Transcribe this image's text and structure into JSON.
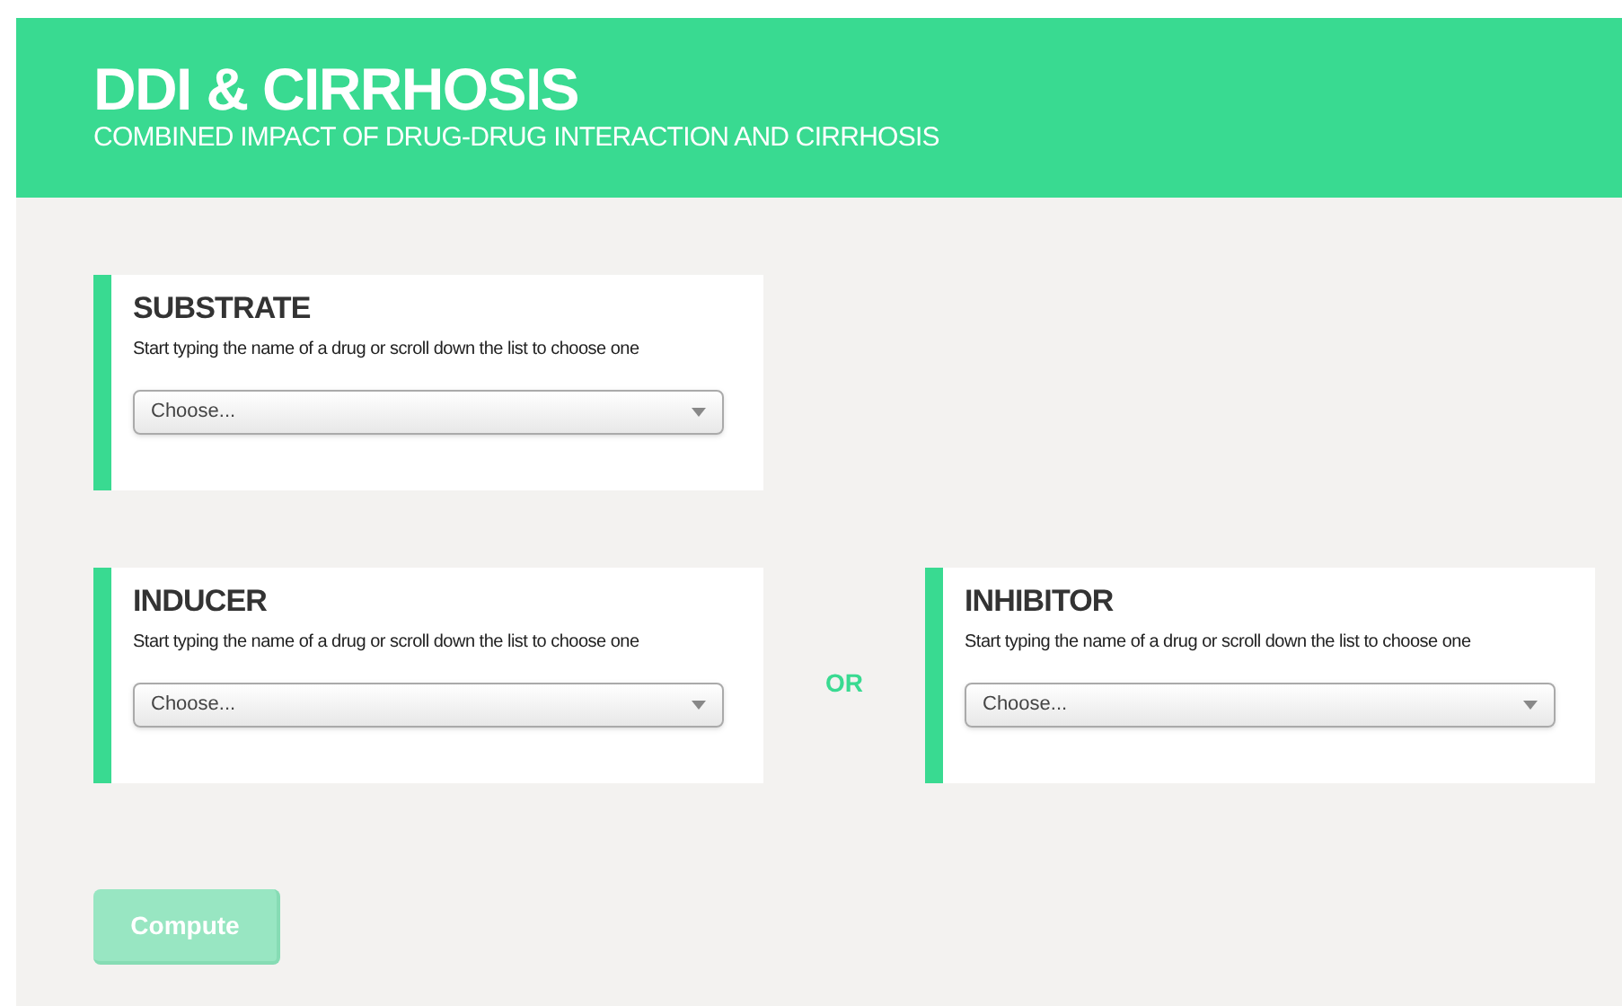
{
  "header": {
    "title": "DDI & CIRRHOSIS",
    "subtitle": "COMBINED IMPACT OF DRUG-DRUG INTERACTION AND CIRRHOSIS"
  },
  "substrate": {
    "title": "SUBSTRATE",
    "description": "Start typing the name of a drug or scroll down the list to choose one",
    "select": "Choose..."
  },
  "inducer": {
    "title": "INDUCER",
    "description": "Start typing the name of a drug or scroll down the list to choose one",
    "select": "Choose..."
  },
  "separator": "OR",
  "inhibitor": {
    "title": "INHIBITOR",
    "description": "Start typing the name of a drug or scroll down the list to choose one",
    "select": "Choose..."
  },
  "compute_button": {
    "label": "Compute",
    "disabled": true
  }
}
